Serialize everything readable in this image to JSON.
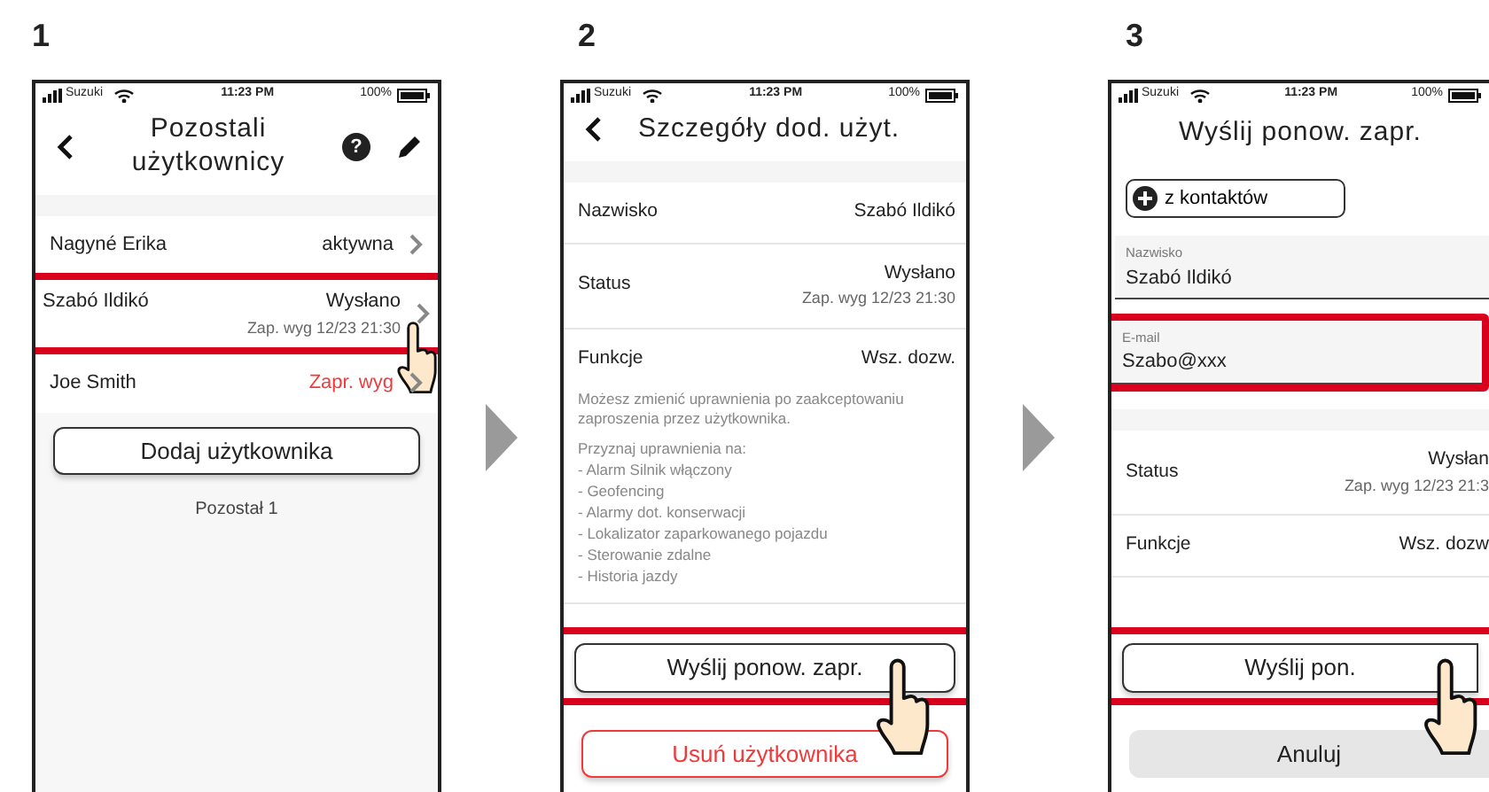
{
  "steps": [
    {
      "number": "1",
      "kind": "user_list",
      "status_bar": {
        "carrier": "Suzuki",
        "time": "11:23 PM",
        "battery": "100%"
      },
      "header": {
        "title": "Pozostali użytkownicy",
        "back": true,
        "help": "?",
        "edit": true
      },
      "sections": [
        {
          "kind": "band"
        },
        {
          "kind": "user_row",
          "name": "Nagyné Erika",
          "status": "aktywna",
          "alert": false,
          "highlighted": false,
          "tapped": false
        },
        {
          "kind": "user_row",
          "name": "Szabó Ildikó",
          "status": "Wysłano",
          "note": "Zap. wyg 12/23 21:30",
          "alert": false,
          "highlighted": true,
          "tapped": true
        },
        {
          "kind": "user_row",
          "name": "Joe Smith",
          "status": "Zapr. wyg",
          "alert": true,
          "highlighted": false,
          "tapped": false
        },
        {
          "kind": "button",
          "label": "Dodaj użytkownika",
          "highlighted": false,
          "tapped": false
        },
        {
          "kind": "caption",
          "text": "Pozostał 1"
        }
      ]
    },
    {
      "number": "2",
      "kind": "user_details",
      "status_bar": {
        "carrier": "Suzuki",
        "time": "11:23 PM",
        "battery": "100%"
      },
      "header": {
        "title": "Szczegóły dod. użyt.",
        "back": true,
        "edit": false
      },
      "sections": [
        {
          "kind": "band"
        },
        {
          "kind": "detail_row",
          "label": "Nazwisko",
          "value": "Szabó Ildikó"
        },
        {
          "kind": "detail_row",
          "label": "Status",
          "value": "Wysłano",
          "note": "Zap. wyg 12/23 21:30"
        },
        {
          "kind": "detail_row",
          "label": "Funkcje",
          "value": "Wsz. dozw.",
          "open": true
        },
        {
          "kind": "note",
          "paragraph": "Możesz zmienić uprawnienia po zaakceptowaniu zaproszenia przez użytkownika.",
          "heading": "Przyznaj uprawnienia na:",
          "items": [
            "- Alarm Silnik włączony",
            "- Geofencing",
            "- Alarmy dot. konserwacji",
            "- Lokalizator zaparkowanego pojazdu",
            "- Sterowanie zdalne",
            "- Historia jazdy"
          ]
        },
        {
          "kind": "spacer"
        },
        {
          "kind": "button",
          "label": "Wyślij ponow. zapr.",
          "highlighted": true,
          "tapped": true
        },
        {
          "kind": "danger_button",
          "label": "Usuń użytkownika",
          "highlighted": false,
          "tapped": false
        }
      ]
    },
    {
      "number": "3",
      "kind": "resend_form",
      "status_bar": {
        "carrier": "Suzuki",
        "time": "11:23 PM",
        "battery": "100%"
      },
      "header": {
        "title": "Wyślij ponow. zapr.",
        "back": false,
        "edit": false
      },
      "sections": [
        {
          "kind": "contact_button",
          "label": "z kontaktów"
        },
        {
          "kind": "field",
          "label": "Nazwisko",
          "value": "Szabó Ildikó",
          "highlighted": false
        },
        {
          "kind": "field",
          "label": "E-mail",
          "value": "Szabo@xxx",
          "highlighted": true
        },
        {
          "kind": "band"
        },
        {
          "kind": "detail_row",
          "label": "Status",
          "value": "Wysłan",
          "note": "Zap. wyg 12/23 21:3"
        },
        {
          "kind": "detail_row",
          "label": "Funkcje",
          "value": "Wsz. dozw",
          "open": false
        },
        {
          "kind": "spacer"
        },
        {
          "kind": "button",
          "label": "Wyślij pon.",
          "highlighted": true,
          "tapped": true
        },
        {
          "kind": "secondary_button",
          "label": "Anuluj",
          "highlighted": false,
          "tapped": false
        }
      ]
    }
  ]
}
